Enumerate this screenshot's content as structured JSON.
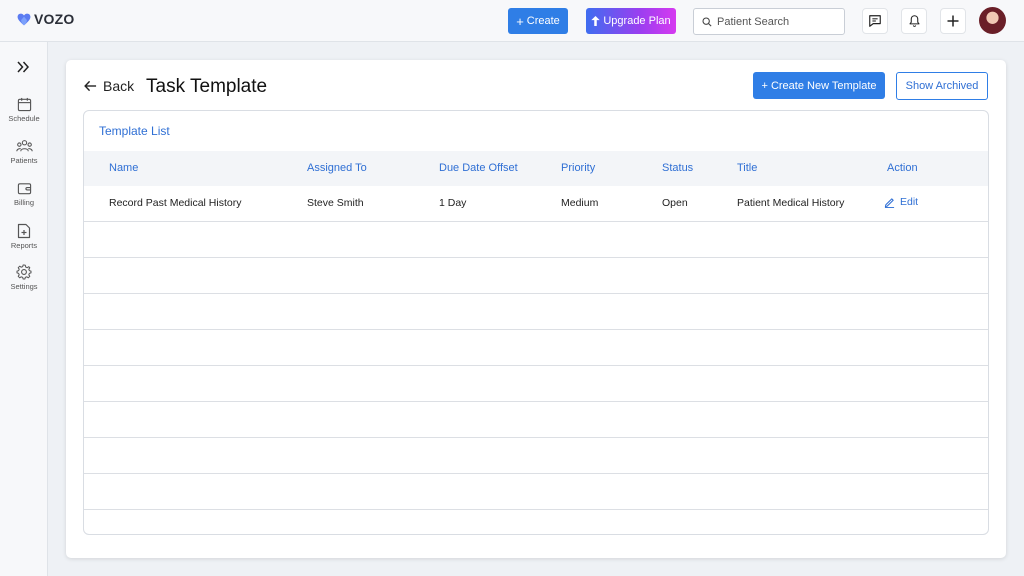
{
  "topbar": {
    "brand": "VOZO",
    "create_label": "Create",
    "upgrade_label": "Upgrade Plan",
    "search_placeholder": "Patient Search"
  },
  "sidebar": {
    "items": [
      {
        "label": "Schedule",
        "icon": "calendar-icon"
      },
      {
        "label": "Patients",
        "icon": "patients-icon"
      },
      {
        "label": "Billing",
        "icon": "wallet-icon"
      },
      {
        "label": "Reports",
        "icon": "report-icon"
      },
      {
        "label": "Settings",
        "icon": "gear-icon"
      }
    ]
  },
  "page": {
    "back_label": "Back",
    "title": "Task Template",
    "create_new_label": "+ Create New Template",
    "show_archived_label": "Show Archived"
  },
  "template_list": {
    "title": "Template List",
    "columns": [
      "Name",
      "Assigned To",
      "Due Date Offset",
      "Priority",
      "Status",
      "Title",
      "Action"
    ],
    "rows": [
      {
        "name": "Record Past Medical History",
        "assigned_to": "Steve Smith",
        "due_date_offset": "1 Day",
        "priority": "Medium",
        "status": "Open",
        "title": "Patient Medical History",
        "action": "Edit"
      }
    ]
  },
  "colors": {
    "accent": "#2f7ee6",
    "link": "#2f6fd4",
    "header_bg": "#f3f5f8"
  }
}
